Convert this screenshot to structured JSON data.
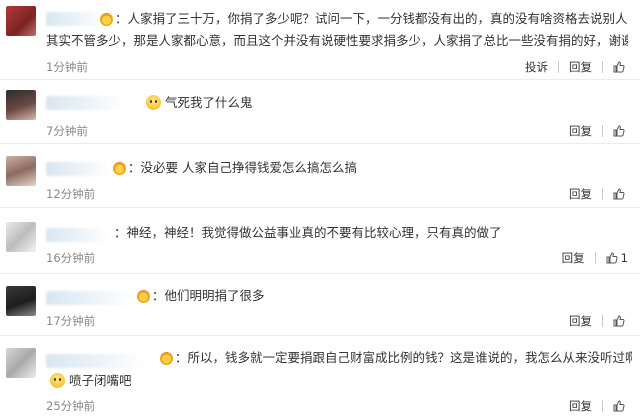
{
  "comments": [
    {
      "text_line1": "：人家捐了三十万，你捐了多少呢？试问一下，一分钱都没有出的，真的没有啥资格去说别人。",
      "text_line2": "其实不管多少，那是人家都心意，而且这个并没有说硬性要求捐多少，人家捐了总比一些没有捐的好，谢谢",
      "time": "1分钟前",
      "report_label": "投诉",
      "reply_label": "回复"
    },
    {
      "text_line1": "气死我了什么鬼",
      "time": "7分钟前",
      "reply_label": "回复"
    },
    {
      "text_line1": "：没必要 人家自己挣得钱爱怎么搞怎么搞",
      "time": "12分钟前",
      "reply_label": "回复"
    },
    {
      "text_line1": "：神经，神经！我觉得做公益事业真的不要有比较心理，只有真的做了",
      "time": "16分钟前",
      "reply_label": "回复",
      "like_count": "1"
    },
    {
      "text_line1": "：他们明明捐了很多",
      "time": "17分钟前",
      "reply_label": "回复"
    },
    {
      "text_line1": "：所以，钱多就一定要捐跟自己财富成比例的钱？这是谁说的，我怎么从来没听过啊",
      "text_line2": "喷子闭嘴吧",
      "time": "25分钟前",
      "reply_label": "回复"
    }
  ]
}
